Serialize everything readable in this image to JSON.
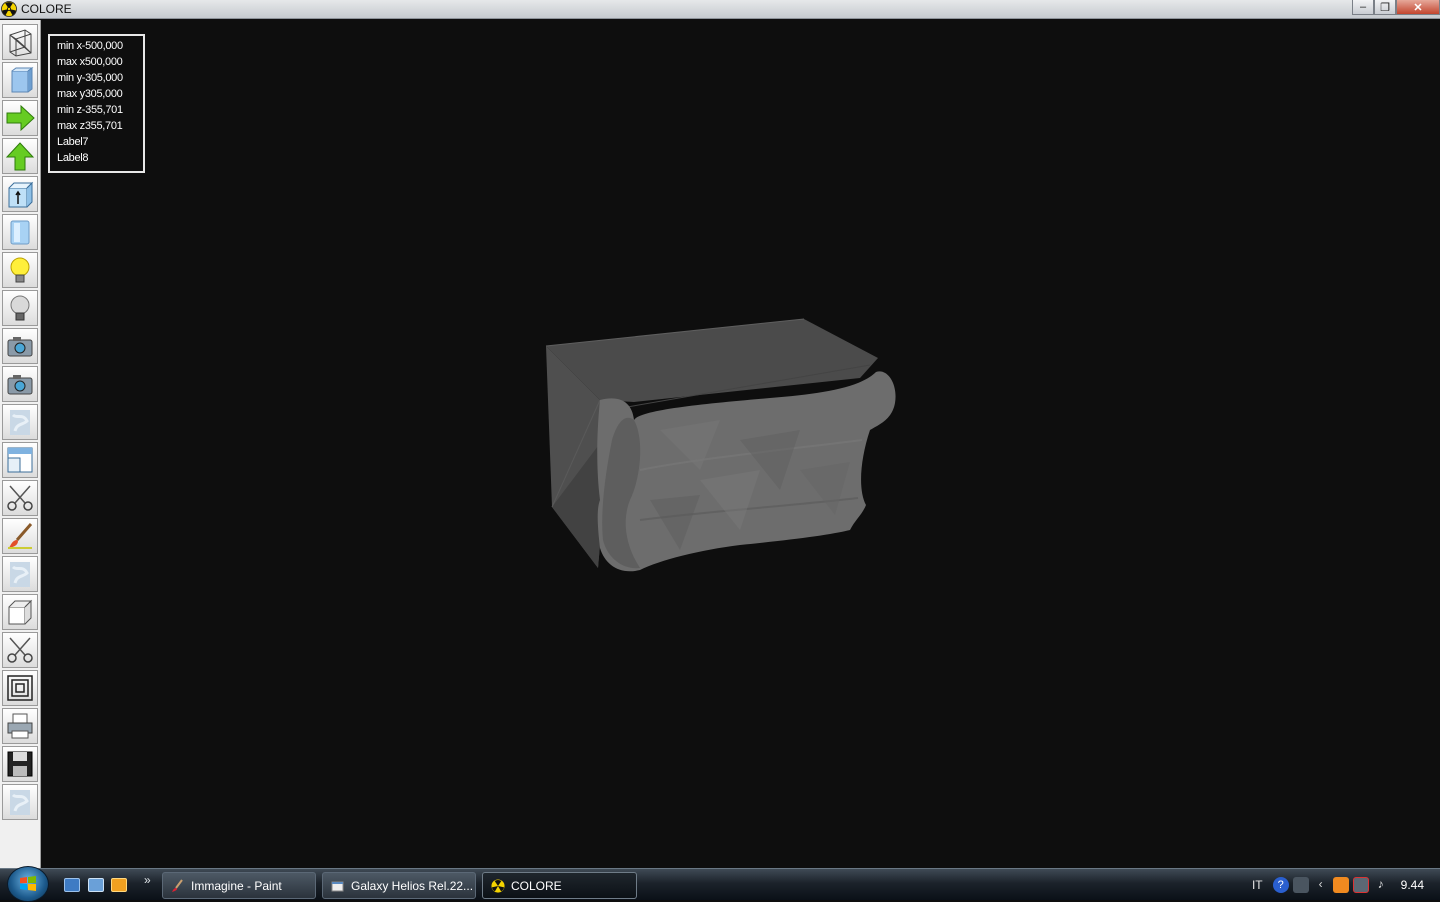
{
  "window": {
    "title": "COLORE"
  },
  "info_panel": {
    "lines": [
      "min x-500,000",
      "max x500,000",
      "min y-305,000",
      "max y305,000",
      "min z-355,701",
      "max z355,701",
      "Label7",
      "Label8"
    ]
  },
  "toolbar": {
    "tools": [
      "wireframe-icon",
      "solid-view-icon",
      "arrow-right-icon",
      "arrow-up-icon",
      "view-cube-icon",
      "shaded-view-icon",
      "light-on-icon",
      "light-off-icon",
      "camera-icon",
      "camera-icon",
      "texture-icon",
      "window-icon",
      "scissors-icon",
      "brush-icon",
      "texture-icon",
      "box-icon",
      "scissors-icon",
      "layers-icon",
      "printer-icon",
      "save-disk-icon",
      "texture-icon"
    ]
  },
  "taskbar": {
    "tasks": [
      {
        "label": "Immagine - Paint",
        "icon": "paint-icon"
      },
      {
        "label": "Galaxy Helios  Rel.22...",
        "icon": "app-window-icon"
      },
      {
        "label": "COLORE",
        "icon": "radiation-icon"
      }
    ],
    "language": "IT",
    "clock": "9.44"
  },
  "colors": {
    "viewport_bg": "#0e0e0e",
    "model_gray": "#6c6c6c",
    "taskbar": "#1c232b"
  }
}
